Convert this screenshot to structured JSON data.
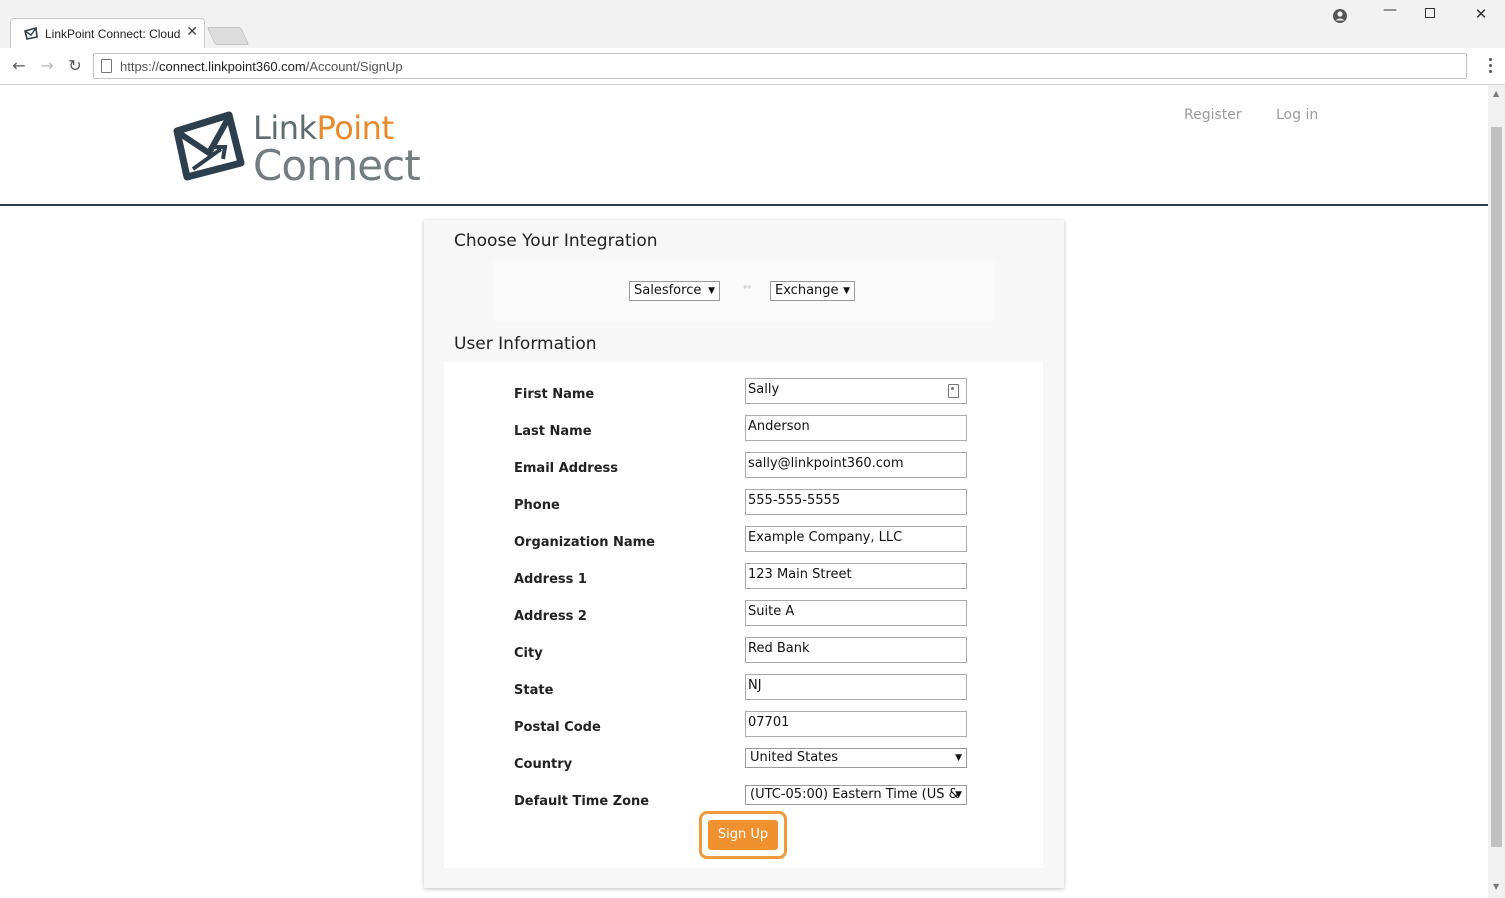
{
  "browser": {
    "tab_title": "LinkPoint Connect: Cloud",
    "url_scheme": "https://",
    "url_host": "connect.linkpoint360.com",
    "url_path": "/Account/SignUp"
  },
  "header": {
    "logo_line1_part1": "Link",
    "logo_line1_part2": "Point",
    "logo_line2": "Connect",
    "nav": [
      {
        "label": "Register"
      },
      {
        "label": "Log in"
      }
    ]
  },
  "integration": {
    "title": "Choose Your Integration",
    "crm_selected": "Salesforce",
    "email_selected": "Exchange",
    "separator": "↔"
  },
  "user_info": {
    "title": "User Information",
    "fields": [
      {
        "label": "First Name",
        "value": "Sally"
      },
      {
        "label": "Last Name",
        "value": "Anderson"
      },
      {
        "label": "Email Address",
        "value": "sally@linkpoint360.com"
      },
      {
        "label": "Phone",
        "value": "555-555-5555"
      },
      {
        "label": "Organization Name",
        "value": "Example Company, LLC"
      },
      {
        "label": "Address 1",
        "value": "123 Main Street"
      },
      {
        "label": "Address 2",
        "value": "Suite A"
      },
      {
        "label": "City",
        "value": "Red Bank"
      },
      {
        "label": "State",
        "value": "NJ"
      },
      {
        "label": "Postal Code",
        "value": "07701"
      },
      {
        "label": "Country",
        "value": "United States"
      },
      {
        "label": "Default Time Zone",
        "value": "(UTC-05:00) Eastern Time (US &"
      }
    ],
    "submit_label": "Sign Up"
  },
  "colors": {
    "brand_orange": "#f0902f",
    "brand_gray": "#737c80",
    "brand_navy": "#2d3e4c"
  }
}
